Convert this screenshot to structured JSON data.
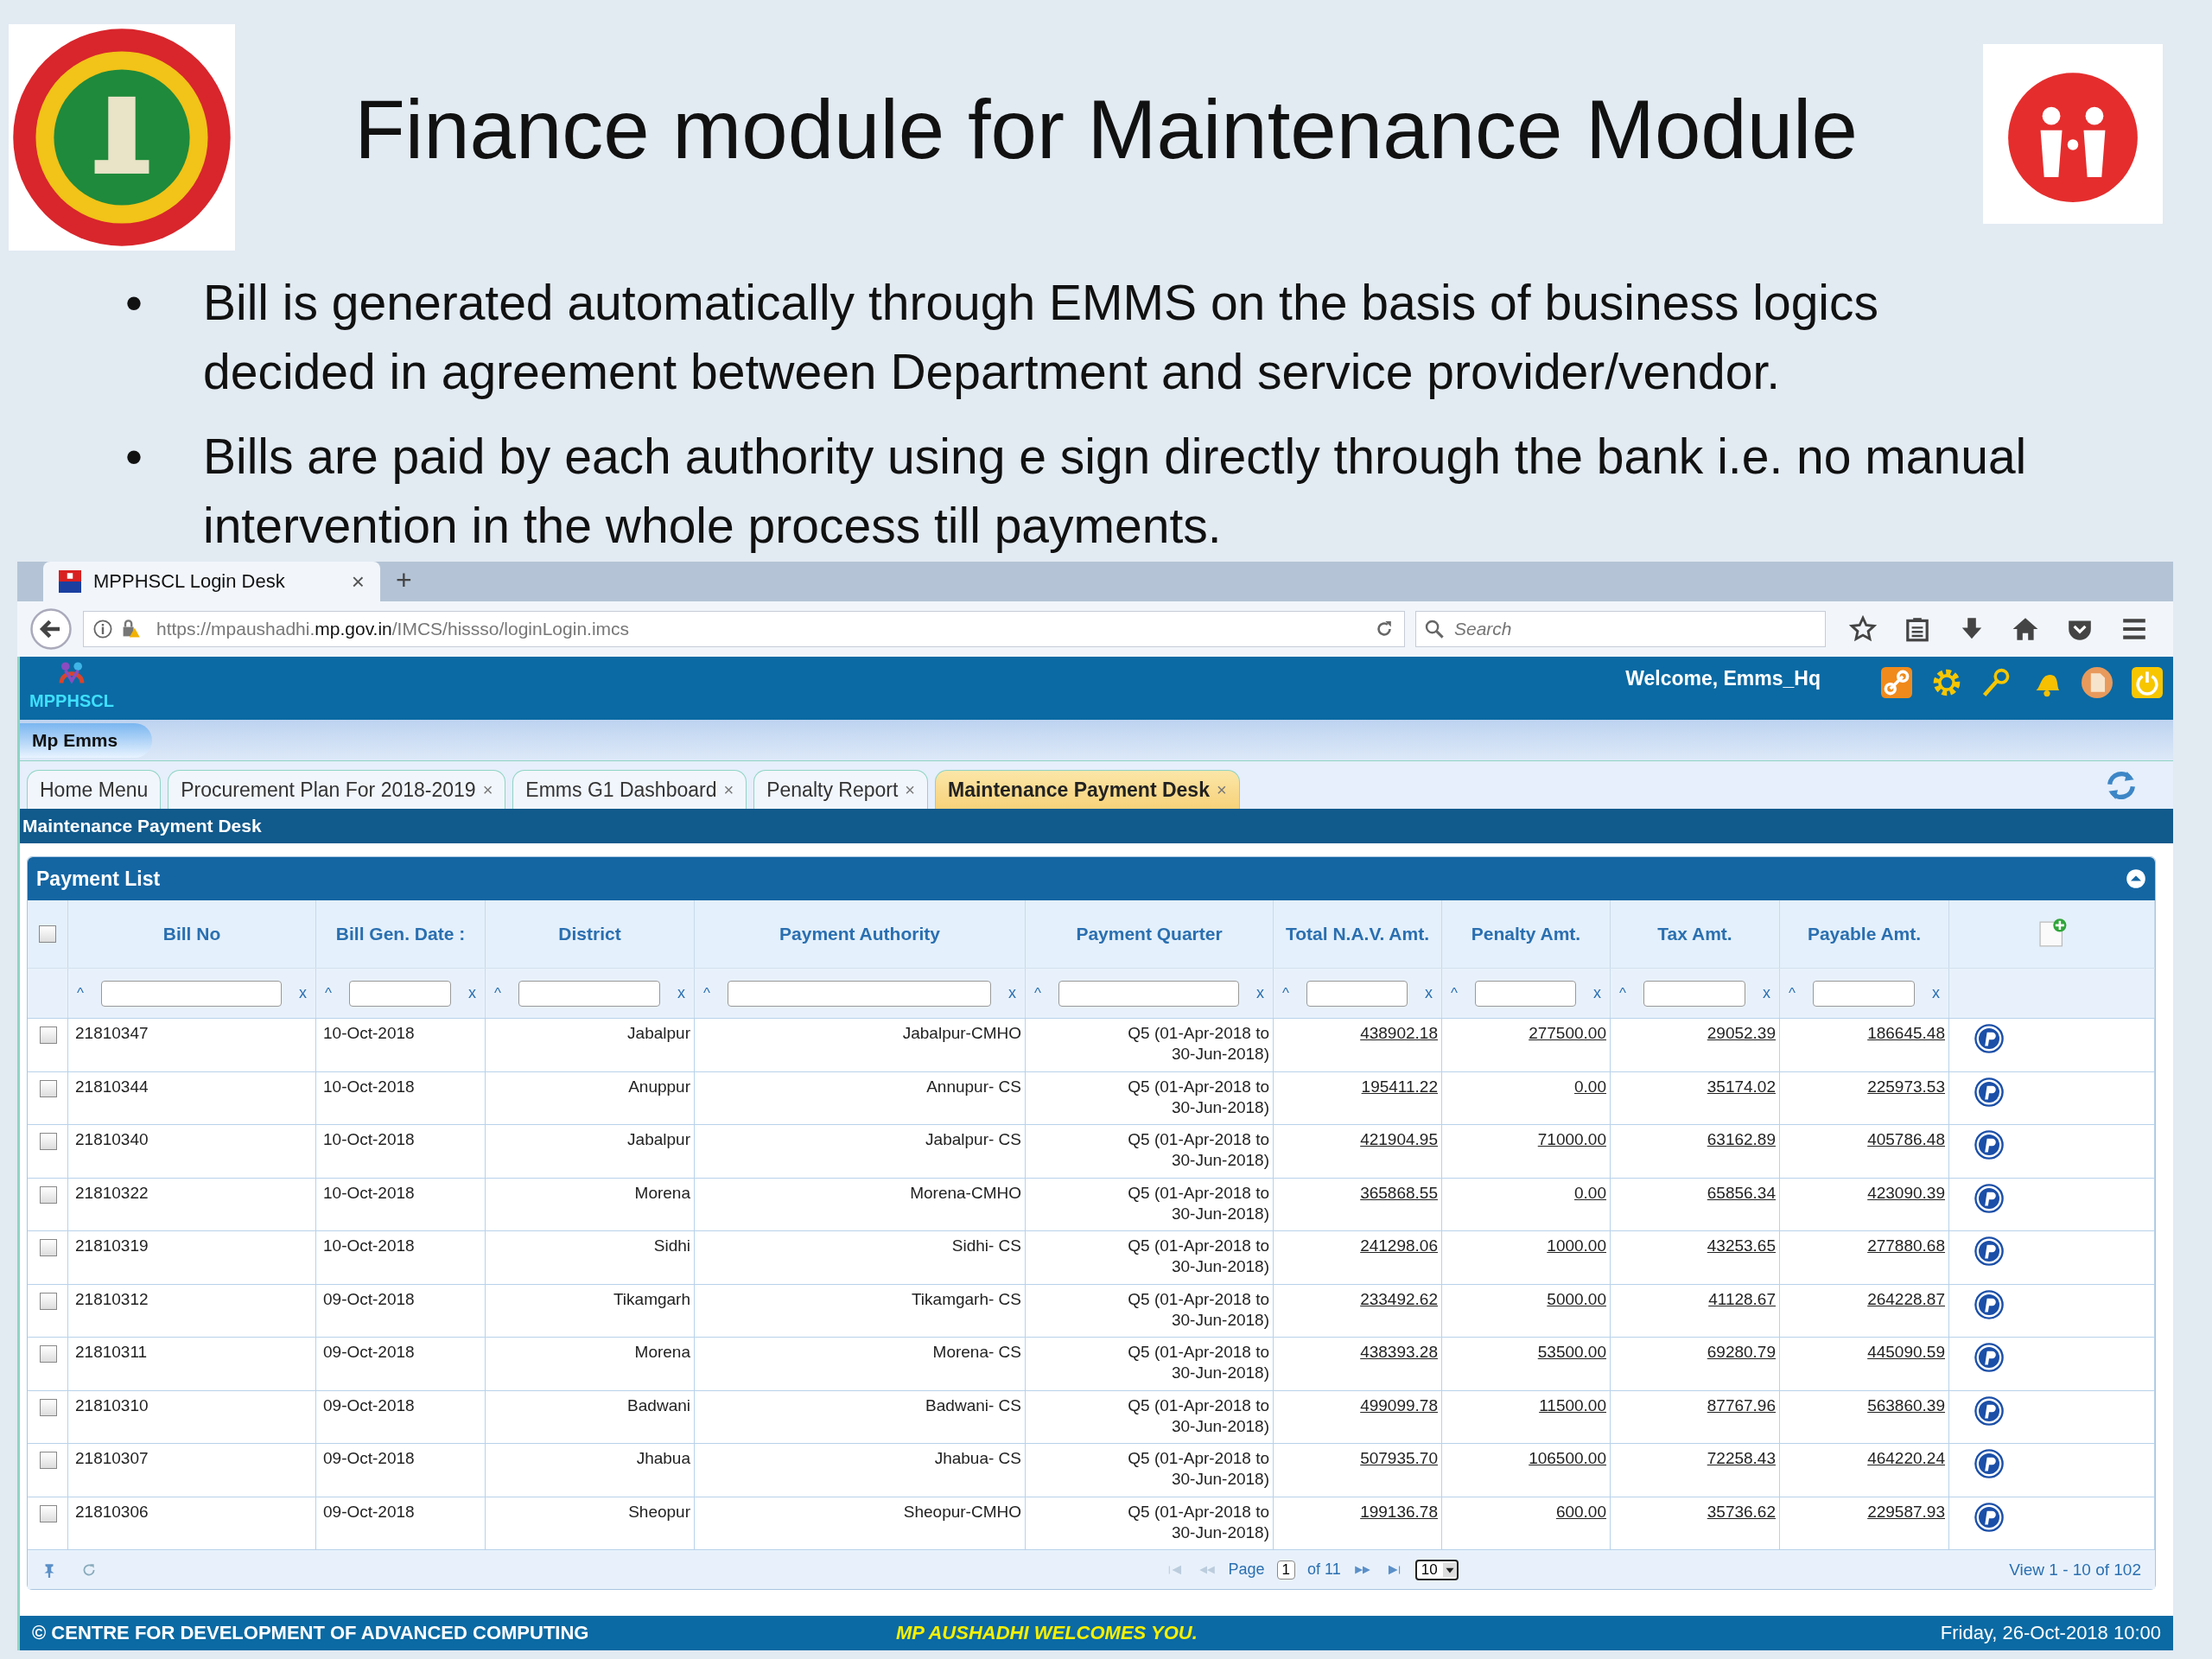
{
  "slide": {
    "title": "Finance module for Maintenance Module",
    "bullets": [
      "Bill is generated automatically through EMMS on the basis of business logics decided in agreement between Department and service provider/vendor.",
      "Bills are paid by each authority using e sign directly through the bank i.e. no manual intervention in the whole process till payments."
    ],
    "bullet_mark": "•"
  },
  "browser": {
    "tab_title": "MPPHSCL Login Desk",
    "tab_close": "×",
    "new_tab": "+",
    "url": "https://mpaushadhi.**mp.gov.in**/IMCS/hissso/loginLogin.imcs",
    "search": {
      "placeholder": "Search"
    }
  },
  "app": {
    "logo_text": "MPPHSCL",
    "welcome": "Welcome, Emms_Hq",
    "menu_pill": "Mp Emms",
    "tabs": [
      {
        "label": "Home Menu",
        "selected": false
      },
      {
        "label": "Procurement Plan For 2018-2019",
        "close": "×",
        "selected": false
      },
      {
        "label": "Emms G1 Dashboard",
        "close": "×",
        "selected": false
      },
      {
        "label": "Penalty Report",
        "close": "×",
        "selected": false
      },
      {
        "label": "Maintenance Payment Desk",
        "close": "×",
        "selected": true
      }
    ],
    "section_title": "Maintenance Payment Desk",
    "panel_title": "Payment List",
    "table": {
      "select_all": {
        "checked": false
      },
      "columns": [
        {
          "label": "Bill No",
          "kind": "text",
          "filter_sort": "^",
          "filter_clear": "x"
        },
        {
          "label": "Bill Gen. Date :",
          "kind": "text",
          "filter_sort": "^",
          "filter_clear": "x"
        },
        {
          "label": "District",
          "kind": "right",
          "filter_sort": "^",
          "filter_clear": "x"
        },
        {
          "label": "Payment Authority",
          "kind": "right",
          "filter_sort": "^",
          "filter_clear": "x"
        },
        {
          "label": "Payment Quarter",
          "kind": "right",
          "filter_sort": "^",
          "filter_clear": "x"
        },
        {
          "label": "Total N.A.V. Amt.",
          "kind": "link",
          "filter_sort": "^",
          "filter_clear": "x"
        },
        {
          "label": "Penalty Amt.",
          "kind": "link",
          "filter_sort": "^",
          "filter_clear": "x"
        },
        {
          "label": "Tax Amt.",
          "kind": "link",
          "filter_sort": "^",
          "filter_clear": "x"
        },
        {
          "label": "Payable Amt.",
          "kind": "link",
          "filter_sort": "^",
          "filter_clear": "x"
        }
      ],
      "rows": [
        {
          "checked": false,
          "cells": [
            "21810347",
            "10-Oct-2018",
            "Jabalpur",
            "Jabalpur-CMHO",
            "Q5 (01-Apr-2018 to 30-Jun-2018)",
            "438902.18",
            "277500.00",
            "29052.39",
            "186645.48"
          ]
        },
        {
          "checked": false,
          "cells": [
            "21810344",
            "10-Oct-2018",
            "Anuppur",
            "Annupur- CS",
            "Q5 (01-Apr-2018 to 30-Jun-2018)",
            "195411.22",
            "0.00",
            "35174.02",
            "225973.53"
          ]
        },
        {
          "checked": false,
          "cells": [
            "21810340",
            "10-Oct-2018",
            "Jabalpur",
            "Jabalpur- CS",
            "Q5 (01-Apr-2018 to 30-Jun-2018)",
            "421904.95",
            "71000.00",
            "63162.89",
            "405786.48"
          ]
        },
        {
          "checked": false,
          "cells": [
            "21810322",
            "10-Oct-2018",
            "Morena",
            "Morena-CMHO",
            "Q5 (01-Apr-2018 to 30-Jun-2018)",
            "365868.55",
            "0.00",
            "65856.34",
            "423090.39"
          ]
        },
        {
          "checked": false,
          "cells": [
            "21810319",
            "10-Oct-2018",
            "Sidhi",
            "Sidhi- CS",
            "Q5 (01-Apr-2018 to 30-Jun-2018)",
            "241298.06",
            "1000.00",
            "43253.65",
            "277880.68"
          ]
        },
        {
          "checked": false,
          "cells": [
            "21810312",
            "09-Oct-2018",
            "Tikamgarh",
            "Tikamgarh- CS",
            "Q5 (01-Apr-2018 to 30-Jun-2018)",
            "233492.62",
            "5000.00",
            "41128.67",
            "264228.87"
          ]
        },
        {
          "checked": false,
          "cells": [
            "21810311",
            "09-Oct-2018",
            "Morena",
            "Morena- CS",
            "Q5 (01-Apr-2018 to 30-Jun-2018)",
            "438393.28",
            "53500.00",
            "69280.79",
            "445090.59"
          ]
        },
        {
          "checked": false,
          "cells": [
            "21810310",
            "09-Oct-2018",
            "Badwani",
            "Badwani- CS",
            "Q5 (01-Apr-2018 to 30-Jun-2018)",
            "499099.78",
            "11500.00",
            "87767.96",
            "563860.39"
          ]
        },
        {
          "checked": false,
          "cells": [
            "21810307",
            "09-Oct-2018",
            "Jhabua",
            "Jhabua- CS",
            "Q5 (01-Apr-2018 to 30-Jun-2018)",
            "507935.70",
            "106500.00",
            "72258.43",
            "464220.24"
          ]
        },
        {
          "checked": false,
          "cells": [
            "21810306",
            "09-Oct-2018",
            "Sheopur",
            "Sheopur-CMHO",
            "Q5 (01-Apr-2018 to 30-Jun-2018)",
            "199136.78",
            "600.00",
            "35736.62",
            "229587.93"
          ]
        }
      ]
    },
    "pager": {
      "page_label": "Page",
      "page": "1",
      "of": "of 11",
      "page_size": "10",
      "view": "View 1 - 10 of 102"
    },
    "footer": {
      "left": "© CENTRE FOR DEVELOPMENT OF ADVANCED COMPUTING",
      "center": "MP AUSHADHI WELCOMES YOU.",
      "right": "Friday, 26-Oct-2018 10:00"
    }
  }
}
